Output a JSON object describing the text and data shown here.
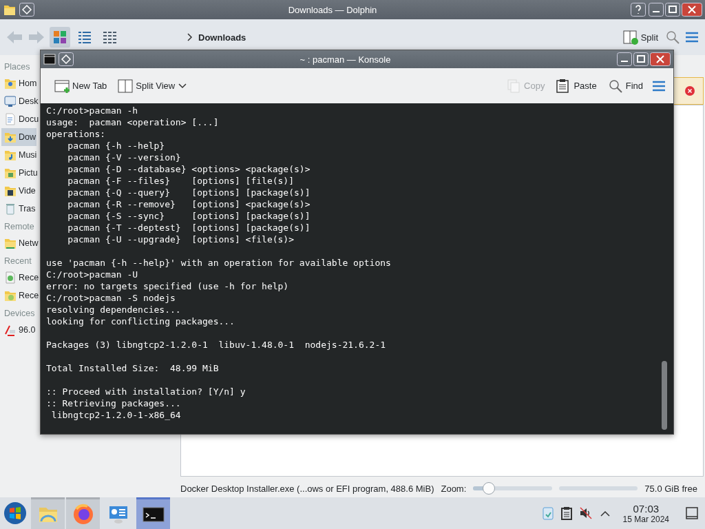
{
  "dolphin": {
    "title": "Downloads — Dolphin",
    "view_modes": [
      {
        "kind": "icons",
        "selected": true
      },
      {
        "kind": "compact",
        "selected": false
      },
      {
        "kind": "details",
        "selected": false
      }
    ],
    "breadcrumb": "Downloads",
    "split_label": "Split",
    "sidebar": [
      {
        "heading": "Places",
        "items": [
          {
            "label": "Hom",
            "kind": "home",
            "selected": false
          },
          {
            "label": "Desk",
            "kind": "desktop",
            "selected": false
          },
          {
            "label": "Docu",
            "kind": "document",
            "selected": false
          },
          {
            "label": "Dow",
            "kind": "download",
            "selected": true
          },
          {
            "label": "Musi",
            "kind": "music",
            "selected": false
          },
          {
            "label": "Pictu",
            "kind": "pictures",
            "selected": false
          },
          {
            "label": "Vide",
            "kind": "video",
            "selected": false
          },
          {
            "label": "Tras",
            "kind": "trash",
            "selected": false
          }
        ]
      },
      {
        "heading": "Remote",
        "items": [
          {
            "label": "Netw",
            "kind": "network",
            "selected": false
          }
        ]
      },
      {
        "heading": "Recent",
        "items": [
          {
            "label": "Rece",
            "kind": "file",
            "selected": false
          },
          {
            "label": "Rece",
            "kind": "folder",
            "selected": false
          }
        ]
      },
      {
        "heading": "Devices",
        "items": [
          {
            "label": "96.0",
            "kind": "drive",
            "selected": false
          }
        ]
      }
    ],
    "status_bar": {
      "text": "Docker Desktop Installer.exe (...ows or EFI program, 488.6 MiB)",
      "zoom_label": "Zoom:",
      "zoom": {
        "level": 0.2
      },
      "free_space": "75.0 GiB free"
    }
  },
  "konsole": {
    "title": "~ : pacman — Konsole",
    "toolbar": [
      {
        "kind": "new-tab",
        "label": "New Tab",
        "disabled": false
      },
      {
        "kind": "split-view",
        "label": "Split View",
        "disabled": false
      },
      {
        "kind": "spacer"
      },
      {
        "kind": "copy",
        "label": "Copy",
        "disabled": true
      },
      {
        "kind": "paste",
        "label": "Paste",
        "disabled": false
      },
      {
        "kind": "find",
        "label": "Find",
        "disabled": false
      },
      {
        "kind": "menu"
      }
    ],
    "lines": [
      {
        "text": "C:/root>pacman -h"
      },
      {
        "text": "usage:  pacman <operation> [...]"
      },
      {
        "text": "operations:"
      },
      {
        "text": "    pacman {-h --help}"
      },
      {
        "text": "    pacman {-V --version}"
      },
      {
        "text": "    pacman {-D --database} <options> <package(s)>"
      },
      {
        "text": "    pacman {-F --files}    [options] [file(s)]"
      },
      {
        "text": "    pacman {-Q --query}    [options] [package(s)]"
      },
      {
        "text": "    pacman {-R --remove}   [options] <package(s)>"
      },
      {
        "text": "    pacman {-S --sync}     [options] [package(s)]"
      },
      {
        "text": "    pacman {-T --deptest}  [options] [package(s)]"
      },
      {
        "text": "    pacman {-U --upgrade}  [options] <file(s)>"
      },
      {
        "text": "use 'pacman {-h --help}' with an operation for available options"
      },
      {
        "text": "C:/root>pacman -U"
      },
      {
        "text": "error: no targets specified (use -h for help)"
      },
      {
        "text": "C:/root>pacman -S nodejs"
      },
      {
        "text": "resolving dependencies..."
      },
      {
        "text": "looking for conflicting packages..."
      },
      {
        "text": "Packages (3) libngtcp2-1.2.0-1  libuv-1.48.0-1  nodejs-21.6.2-1"
      },
      {
        "text": "Total Installed Size:  48.99 MiB"
      },
      {
        "text": ":: Proceed with installation? [Y/n] y"
      },
      {
        "text": ":: Retrieving packages..."
      },
      {
        "text": " libngtcp2-1.2.0-1-x86_64"
      }
    ]
  },
  "taskbar": {
    "apps": [
      {
        "kind": "files",
        "open": true,
        "selected": false
      },
      {
        "kind": "browser",
        "open": true,
        "selected": false
      },
      {
        "kind": "system",
        "open": false,
        "selected": false
      },
      {
        "kind": "terminal",
        "open": true,
        "selected": true
      }
    ],
    "clock": {
      "time": "07:03",
      "date": "15 Mar 2024"
    }
  }
}
